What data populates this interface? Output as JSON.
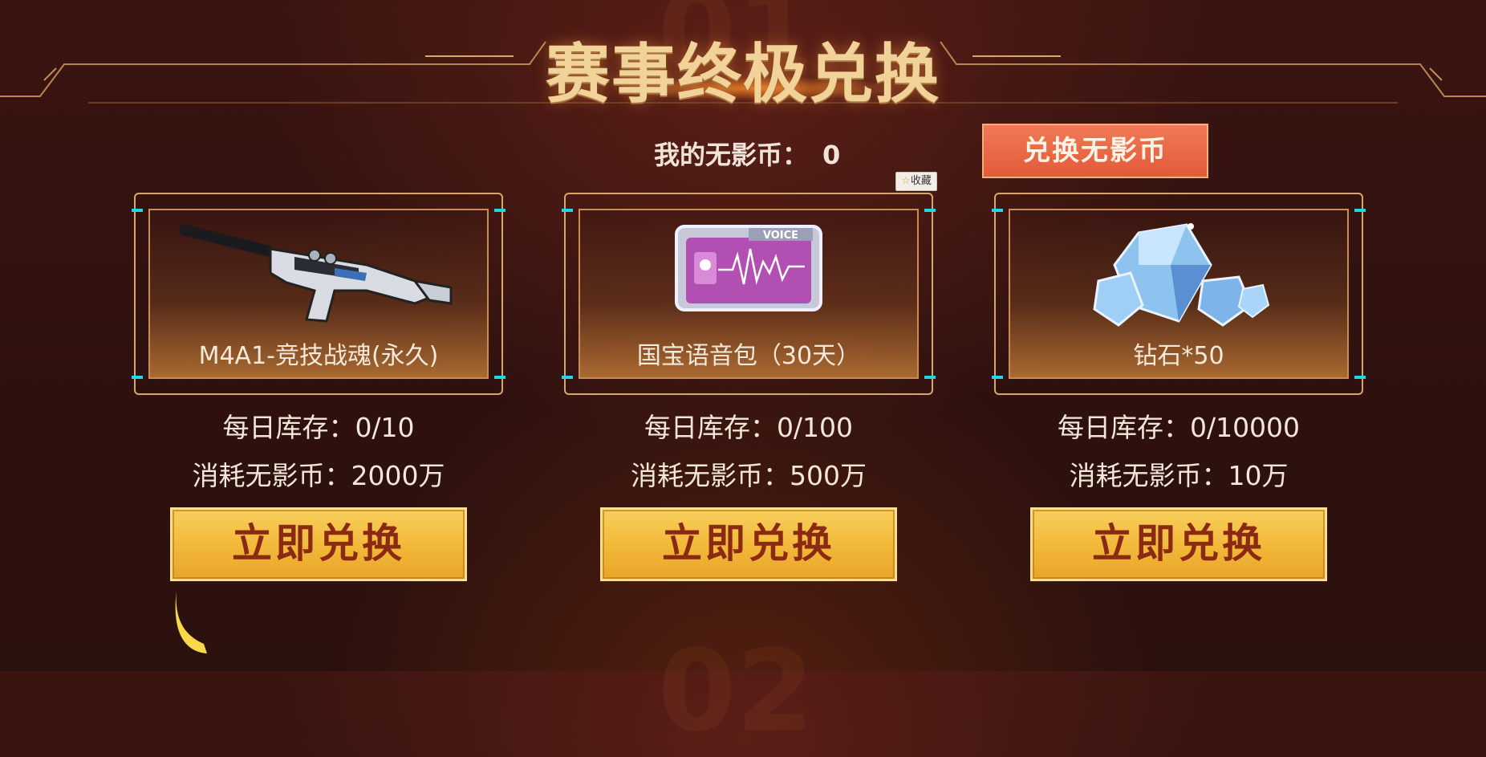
{
  "page": {
    "title": "赛事终极兑换",
    "bg_number_top": "01",
    "bg_number_bottom": "02"
  },
  "currency": {
    "label": "我的无影币：",
    "value": "0",
    "exchange_button": "兑换无影币"
  },
  "favorite_tag": "收藏",
  "products": [
    {
      "name": "M4A1-竞技战魂(永久)",
      "icon": "rifle-icon",
      "stock_label": "每日库存：",
      "stock_value": "0/10",
      "cost_label": "消耗无影币：",
      "cost_value": "2000万",
      "button": "立即兑换"
    },
    {
      "name": "国宝语音包（30天）",
      "icon": "voice-pack-icon",
      "icon_text": "VOICE",
      "stock_label": "每日库存：",
      "stock_value": "0/100",
      "cost_label": "消耗无影币：",
      "cost_value": "500万",
      "button": "立即兑换"
    },
    {
      "name": "钻石*50",
      "icon": "diamond-icon",
      "stock_label": "每日库存：",
      "stock_value": "0/10000",
      "cost_label": "消耗无影币：",
      "cost_value": "10万",
      "button": "立即兑换"
    }
  ],
  "colors": {
    "accent": "#f2b838",
    "button_text": "#8b2a12",
    "coin_button": "#e25a3a",
    "frame": "#d7a66b",
    "corner_accent": "#22d7e3"
  }
}
